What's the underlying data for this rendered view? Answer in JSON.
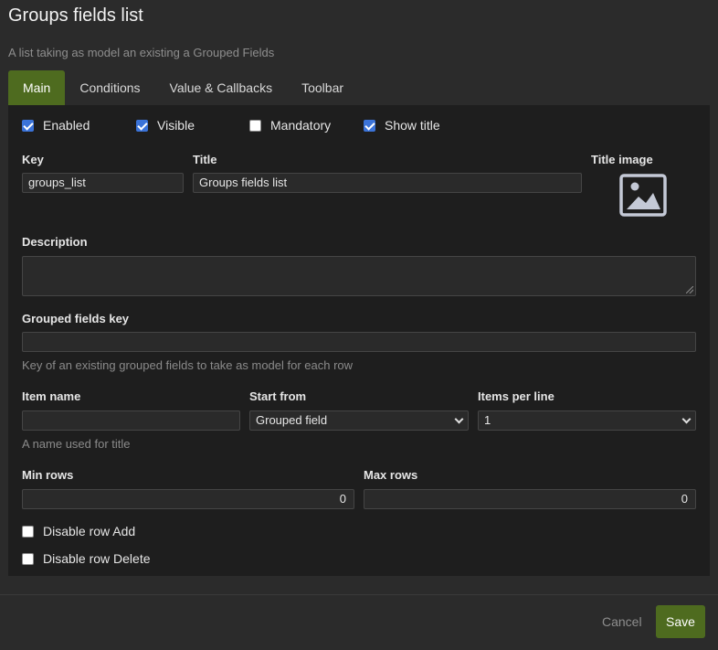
{
  "dialog": {
    "title": "Groups fields list",
    "subtitle": "A list taking as model an existing a Grouped Fields"
  },
  "tabs": [
    {
      "label": "Main",
      "active": true
    },
    {
      "label": "Conditions",
      "active": false
    },
    {
      "label": "Value & Callbacks",
      "active": false
    },
    {
      "label": "Toolbar",
      "active": false
    }
  ],
  "checkboxes": {
    "enabled": {
      "label": "Enabled",
      "checked": true
    },
    "visible": {
      "label": "Visible",
      "checked": true
    },
    "mandatory": {
      "label": "Mandatory",
      "checked": false
    },
    "show_title": {
      "label": "Show title",
      "checked": true
    }
  },
  "fields": {
    "key": {
      "label": "Key",
      "value": "groups_list"
    },
    "title": {
      "label": "Title",
      "value": "Groups fields list"
    },
    "title_image": {
      "label": "Title image",
      "icon": "image-placeholder-icon"
    },
    "description": {
      "label": "Description",
      "value": ""
    },
    "grouped_fields_key": {
      "label": "Grouped fields key",
      "value": "",
      "help": "Key of an existing grouped fields to take as model for each row"
    },
    "item_name": {
      "label": "Item name",
      "value": "",
      "help": "A name used for title"
    },
    "start_from": {
      "label": "Start from",
      "value": "Grouped field"
    },
    "items_per_line": {
      "label": "Items per line",
      "value": "1"
    },
    "min_rows": {
      "label": "Min rows",
      "value": "0"
    },
    "max_rows": {
      "label": "Max rows",
      "value": "0"
    }
  },
  "options": {
    "disable_row_add": {
      "label": "Disable row Add",
      "checked": false
    },
    "disable_row_delete": {
      "label": "Disable row Delete",
      "checked": false
    }
  },
  "footer": {
    "cancel_label": "Cancel",
    "save_label": "Save"
  },
  "colors": {
    "accent": "#4e6b1f",
    "checkbox": "#3b73d8",
    "panel": "#1e1e1e",
    "background": "#2b2b2b"
  }
}
